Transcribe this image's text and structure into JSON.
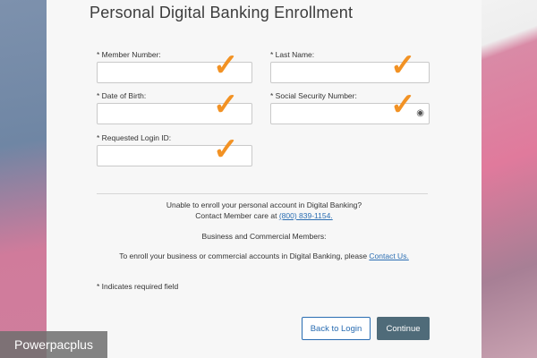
{
  "page": {
    "title": "Personal Digital Banking Enrollment"
  },
  "form": {
    "member_number": {
      "label": "* Member Number:",
      "value": ""
    },
    "last_name": {
      "label": "* Last Name:",
      "value": ""
    },
    "date_of_birth": {
      "label": "* Date of Birth:",
      "value": ""
    },
    "ssn": {
      "label": "* Social Security Number:",
      "value": "",
      "icon": "eye-icon"
    },
    "login_id": {
      "label": "* Requested Login ID:",
      "value": ""
    },
    "checkmark": "✓"
  },
  "help": {
    "line1": "Unable to enroll your personal account in Digital Banking?",
    "line2_prefix": "Contact Member care at ",
    "phone": "(800) 839-1154.",
    "business_heading": "Business and Commercial Members:",
    "business_prefix": "To enroll your business or commercial accounts in Digital Banking, please ",
    "contact_link": "Contact Us."
  },
  "required_note": "* Indicates required field",
  "buttons": {
    "back": "Back to Login",
    "continue": "Continue"
  },
  "watermark": "Powerpacplus",
  "colors": {
    "accent_checkmark": "#f29224",
    "link": "#2a6db2",
    "continue_button": "#4f6b79"
  }
}
